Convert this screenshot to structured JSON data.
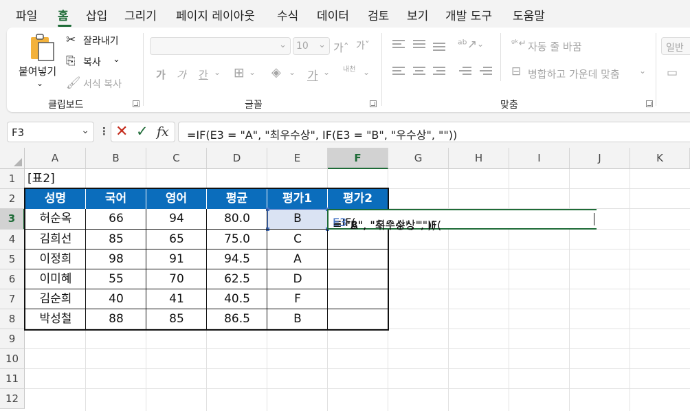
{
  "menu": [
    "파일",
    "홈",
    "삽입",
    "그리기",
    "페이지 레이아웃",
    "수식",
    "데이터",
    "검토",
    "보기",
    "개발 도구",
    "도움말"
  ],
  "menu_active": "홈",
  "ribbon": {
    "clipboard": {
      "paste": "붙여넣기",
      "cut": "잘라내기",
      "copy": "복사",
      "format_painter": "서식 복사",
      "label": "클립보드"
    },
    "font": {
      "size": "10",
      "label": "글꼴",
      "bold": "가",
      "italic": "가",
      "underline": "간",
      "font_color": "가",
      "phonetic": "내천"
    },
    "align": {
      "wrap_text": "자동 줄 바꿈",
      "merge_center": "병합하고 가운데 맞춤",
      "label": "맞춤"
    },
    "number": {
      "format": "일반"
    }
  },
  "formula_bar": {
    "name_box": "F3",
    "formula": "=IF(E3 = \"A\", \"최우수상\", IF(E3 = \"B\", \"우수상\", \"\"))"
  },
  "edit": {
    "p1": "=IF(",
    "r1": "E3",
    "p2": " = \"A\", \"최우수상\", IF(",
    "r2": "E3",
    "p3": " = \"B\", \"우수상\", \"\"))"
  },
  "columns": [
    "A",
    "B",
    "C",
    "D",
    "E",
    "F",
    "G",
    "H",
    "I",
    "J",
    "K"
  ],
  "rows": [
    "1",
    "2",
    "3",
    "4",
    "5",
    "6",
    "7",
    "8",
    "9",
    "10",
    "11",
    "12"
  ],
  "sheet": {
    "title": "[표2]",
    "headers": [
      "성명",
      "국어",
      "영어",
      "평균",
      "평가1",
      "평가2"
    ],
    "data": [
      [
        "허순옥",
        "66",
        "94",
        "80.0",
        "B",
        ""
      ],
      [
        "김희선",
        "85",
        "65",
        "75.0",
        "C",
        ""
      ],
      [
        "이정희",
        "98",
        "91",
        "94.5",
        "A",
        ""
      ],
      [
        "이미혜",
        "55",
        "70",
        "62.5",
        "D",
        ""
      ],
      [
        "김순희",
        "40",
        "41",
        "40.5",
        "F",
        ""
      ],
      [
        "박성철",
        "88",
        "85",
        "86.5",
        "B",
        ""
      ]
    ]
  },
  "colors": {
    "header_fill": "#0b6dbc",
    "accent": "#1e6b37",
    "reference": "#4472c4"
  }
}
